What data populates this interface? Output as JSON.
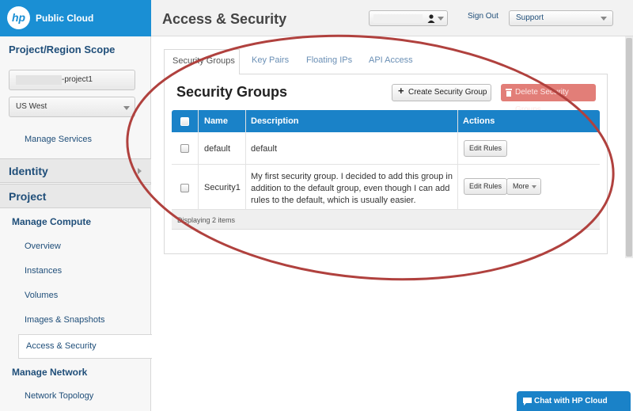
{
  "brand": {
    "logo": "hp",
    "name": "Public Cloud"
  },
  "header": {
    "title": "Access & Security",
    "user_value": "",
    "sign_out": "Sign Out",
    "support": "Support"
  },
  "sidebar": {
    "scope_title": "Project/Region Scope",
    "project_value": "-project1",
    "region_value": "US West",
    "manage_services": "Manage Services",
    "identity": "Identity",
    "project": "Project",
    "manage_compute": "Manage Compute",
    "items": [
      "Overview",
      "Instances",
      "Volumes",
      "Images & Snapshots",
      "Access & Security"
    ],
    "manage_network": "Manage Network",
    "network_topology": "Network Topology"
  },
  "tabs": [
    "Security Groups",
    "Key Pairs",
    "Floating IPs",
    "API Access"
  ],
  "main": {
    "heading": "Security Groups",
    "create_button": "Create Security Group",
    "delete_button": "Delete Security Groups",
    "columns": [
      "Name",
      "Description",
      "Actions"
    ],
    "rows": [
      {
        "name": "default",
        "description": "default",
        "action": "Edit Rules"
      },
      {
        "name": "Security1",
        "description_lines": [
          "My first security group. I decided to add this group in",
          "addition to the default group, even though I can add",
          "rules to the default, which is usually easier."
        ],
        "action": "Edit Rules",
        "more": "More"
      }
    ],
    "footer": "Displaying 2 items"
  },
  "chat": "Chat with HP Cloud",
  "colors": {
    "accent": "#1a82c8",
    "annotation": "#b0413e",
    "delete": "#e27e78"
  }
}
